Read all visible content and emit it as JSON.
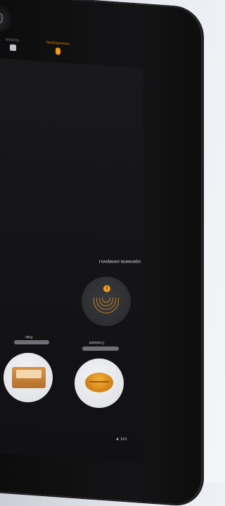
{
  "topbar": {
    "items": [
      {
        "label": "...."
      },
      {
        "label": "Mobility"
      },
      {
        "label": "Tea/Espresso"
      }
    ]
  },
  "action": {
    "label": "Lovepenes ameenepu"
  },
  "products": [
    {
      "label": "Pain",
      "icon": "toast-icon"
    },
    {
      "label": "Croissant",
      "icon": "bun-icon"
    }
  ],
  "footer": {
    "text": "EN ▼"
  },
  "colors": {
    "accent": "#f59a12",
    "screen": "#141416",
    "bezel": "#0d0d0e"
  }
}
